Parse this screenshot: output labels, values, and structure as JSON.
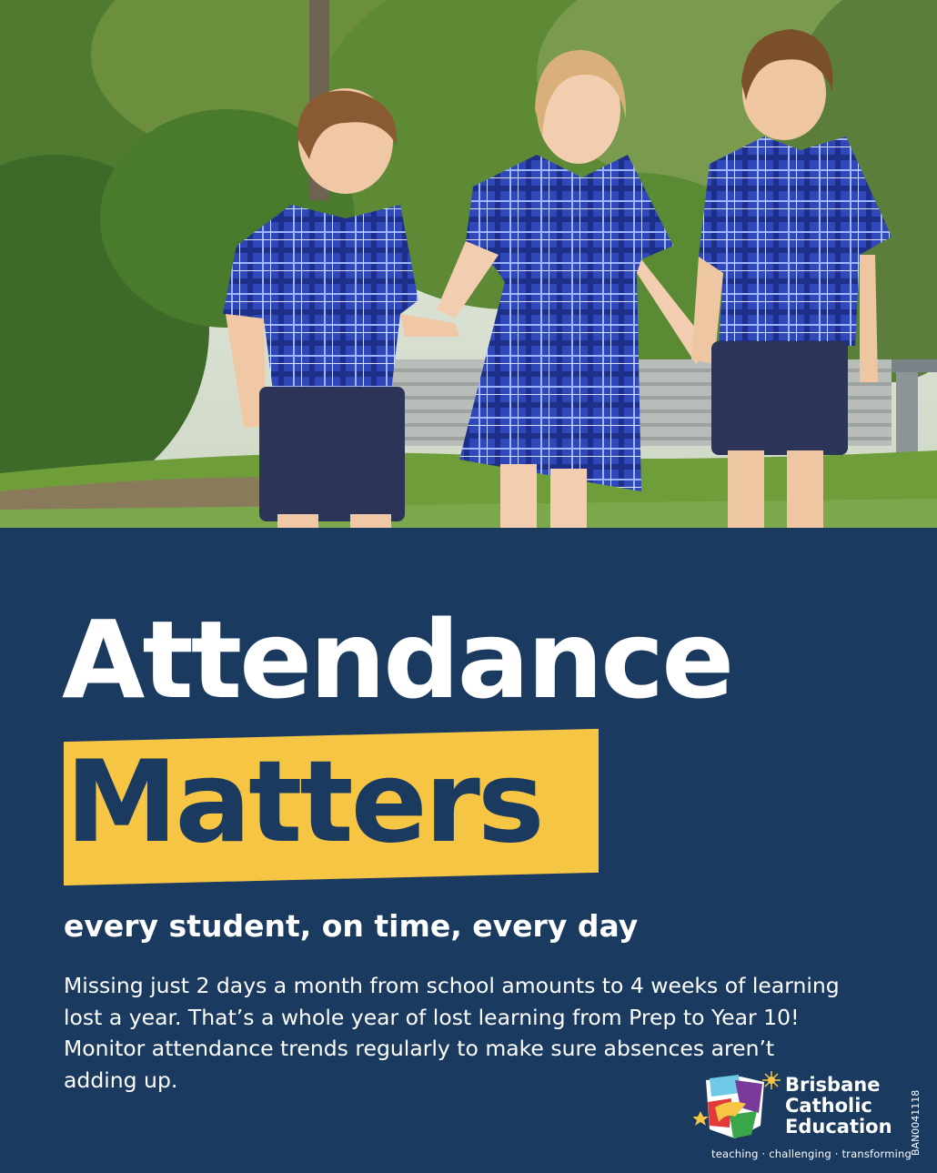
{
  "photo": {
    "description_icon": "children-photo"
  },
  "headline": {
    "line1": "Attendance",
    "line2": "Matters"
  },
  "subtitle": "every student, on time, every day",
  "body": {
    "lines": [
      "Missing just 2 days a month from school amounts to 4 weeks of learning",
      "lost a year. That’s a whole year of lost learning from Prep to Year 10!",
      "Monitor attendance trends regularly to make sure absences aren’t",
      "adding up."
    ]
  },
  "logo": {
    "name_lines": [
      "Brisbane",
      "Catholic",
      "Education"
    ],
    "tagline": "teaching · challenging · transforming",
    "icon": "bce-logo-icon"
  },
  "code": "BAN0041118",
  "colors": {
    "navy": "#1b3a60",
    "yellow": "#f6c544",
    "white": "#ffffff"
  }
}
